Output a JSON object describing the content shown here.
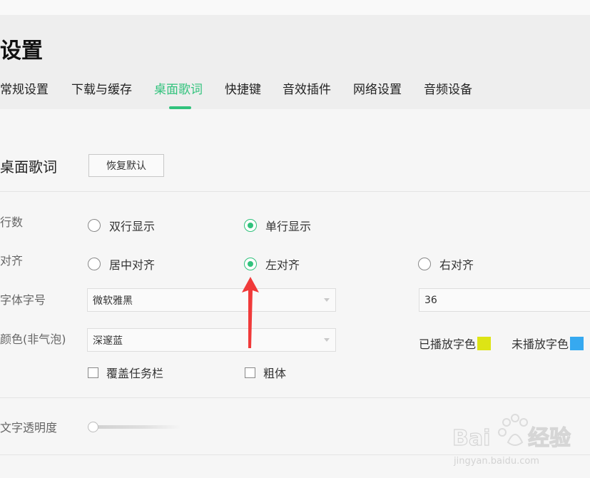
{
  "header": {
    "title": "设置",
    "tabs": [
      {
        "label": "常规设置",
        "active": false
      },
      {
        "label": "下载与缓存",
        "active": false
      },
      {
        "label": "桌面歌词",
        "active": true
      },
      {
        "label": "快捷键",
        "active": false
      },
      {
        "label": "音效插件",
        "active": false
      },
      {
        "label": "网络设置",
        "active": false
      },
      {
        "label": "音频设备",
        "active": false
      }
    ],
    "accent_color": "#31c27c"
  },
  "section": {
    "title": "桌面歌词",
    "restore_button": "恢复默认"
  },
  "rows": {
    "lines": {
      "label": "行数",
      "options": [
        {
          "label": "双行显示",
          "checked": false
        },
        {
          "label": "单行显示",
          "checked": true
        }
      ]
    },
    "align": {
      "label": "对齐",
      "options": [
        {
          "label": "居中对齐",
          "checked": false
        },
        {
          "label": "左对齐",
          "checked": true
        },
        {
          "label": "右对齐",
          "checked": false
        }
      ]
    },
    "font": {
      "label": "字体字号",
      "family_value": "微软雅黑",
      "size_value": "36"
    },
    "color": {
      "label": "颜色(非气泡)",
      "scheme_value": "深邃蓝",
      "played_label": "已播放字色",
      "played_color": "#dde415",
      "unplayed_label": "未播放字色",
      "unplayed_color": "#36a9f0"
    },
    "checkboxes": [
      {
        "label": "覆盖任务栏",
        "checked": false
      },
      {
        "label": "粗体",
        "checked": false
      }
    ],
    "opacity": {
      "label": "文字透明度",
      "value": 0.05
    }
  },
  "watermark": {
    "brand": "Bai du 经验",
    "url": "jingyan.baidu.com"
  }
}
